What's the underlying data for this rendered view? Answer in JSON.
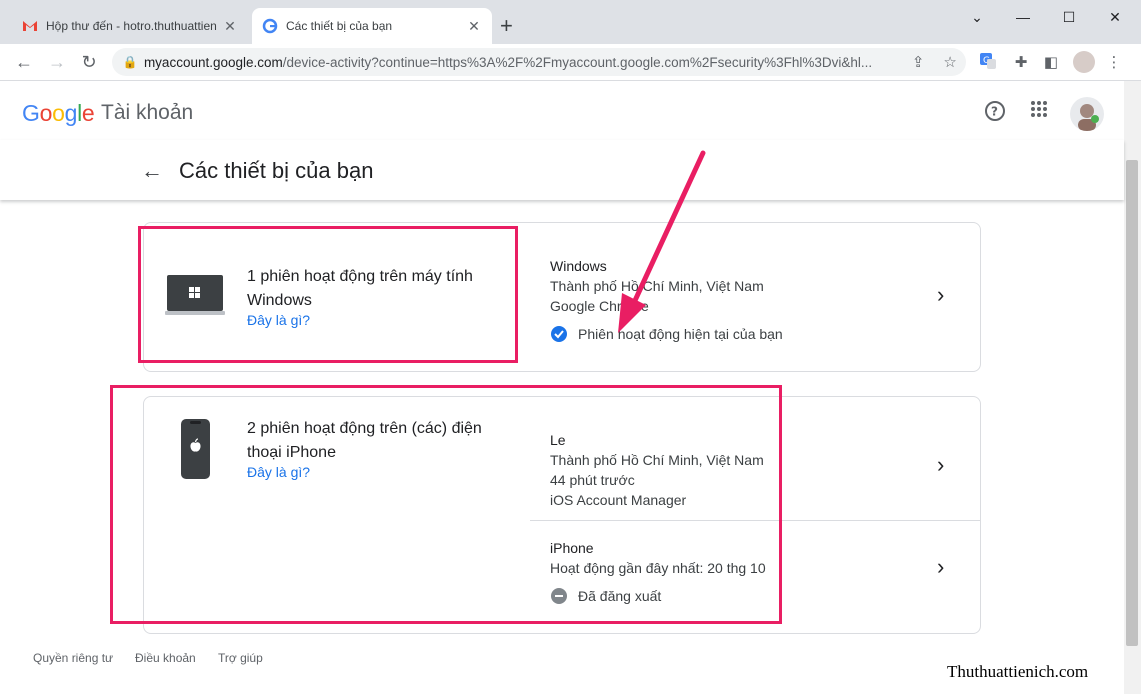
{
  "browser": {
    "tabs": [
      {
        "title": "Hộp thư đến - hotro.thuthuattien"
      },
      {
        "title": "Các thiết bị của bạn"
      }
    ],
    "new_tab": "+",
    "url_host": "myaccount.google.com",
    "url_rest": "/device-activity?continue=https%3A%2F%2Fmyaccount.google.com%2Fsecurity%3Fhl%3Dvi&hl..."
  },
  "header": {
    "logo": "Google",
    "product": "Tài khoản"
  },
  "page": {
    "title": "Các thiết bị của bạn"
  },
  "devices": [
    {
      "title": "1 phiên hoạt động trên máy tính Windows",
      "what_link": "Đây là gì?",
      "sessions": [
        {
          "name": "Windows",
          "location": "Thành phố Hồ Chí Minh, Việt Nam",
          "detail": "Google Chrome",
          "status": "Phiên hoạt động hiện tại của bạn"
        }
      ]
    },
    {
      "title": "2 phiên hoạt động trên (các) điện thoại iPhone",
      "what_link": "Đây là gì?",
      "sessions": [
        {
          "name": "Le",
          "location": "Thành phố Hồ Chí Minh, Việt Nam",
          "time": "44 phút trước",
          "detail": "iOS Account Manager"
        },
        {
          "name": "iPhone",
          "detail": "Hoạt động gần đây nhất: 20 thg 10",
          "status": "Đã đăng xuất"
        }
      ]
    }
  ],
  "footer": {
    "privacy": "Quyền riêng tư",
    "terms": "Điều khoản",
    "help": "Trợ giúp"
  },
  "watermark": "Thuthuattienich.com",
  "colors": {
    "highlight": "#e91e63",
    "link": "#1a73e8",
    "arrow": "#e91e63"
  }
}
